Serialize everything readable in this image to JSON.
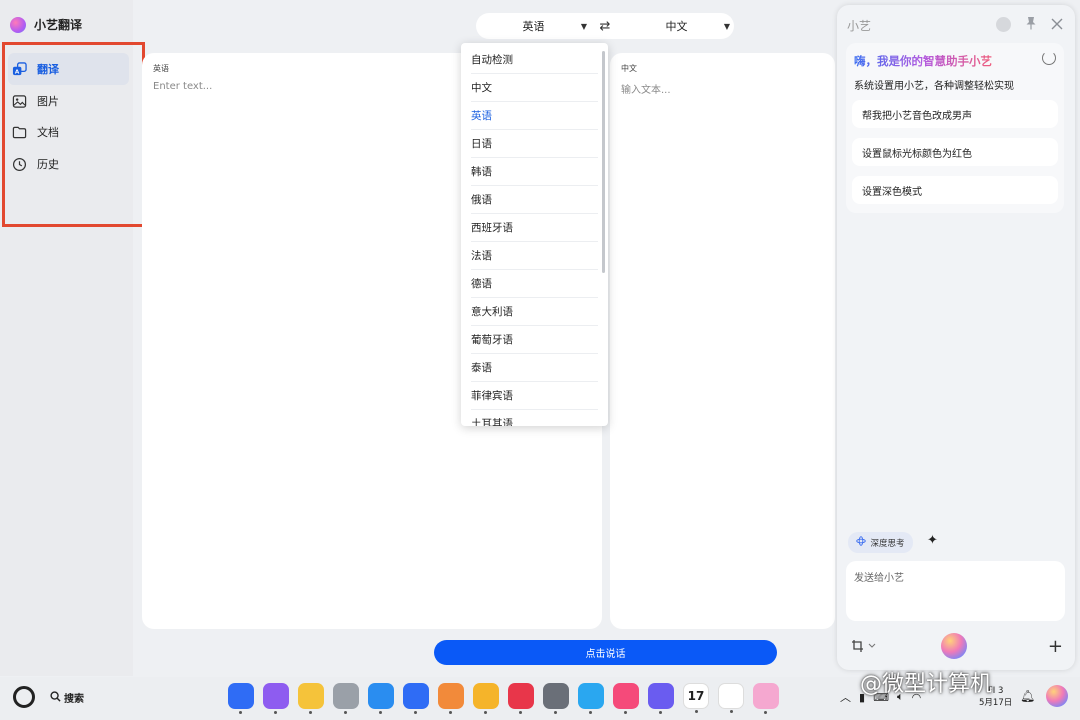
{
  "app": {
    "title": "小艺翻译"
  },
  "sidebar": {
    "items": [
      {
        "label": "翻译",
        "icon": "translate-icon",
        "active": true
      },
      {
        "label": "图片",
        "icon": "image-icon",
        "active": false
      },
      {
        "label": "文档",
        "icon": "folder-icon",
        "active": false
      },
      {
        "label": "历史",
        "icon": "clock-icon",
        "active": false
      }
    ]
  },
  "lang_bar": {
    "source": "英语",
    "target": "中文",
    "swap_symbol": "⇄"
  },
  "source_panel": {
    "label": "英语",
    "placeholder": "Enter text..."
  },
  "target_panel": {
    "label": "中文",
    "placeholder": "输入文本..."
  },
  "dropdown": {
    "selected": "英语",
    "options": [
      "自动检测",
      "中文",
      "英语",
      "日语",
      "韩语",
      "俄语",
      "西班牙语",
      "法语",
      "德语",
      "意大利语",
      "葡萄牙语",
      "泰语",
      "菲律宾语",
      "土耳其语"
    ]
  },
  "speak_button": {
    "label": "点击说话"
  },
  "assistant": {
    "title": "小艺",
    "greeting": "嗨，我是你的智慧助手小艺",
    "subtitle": "系统设置用小艺，各种调整轻松实现",
    "suggestions": [
      "帮我把小艺音色改成男声",
      "设置鼠标光标颜色为红色",
      "设置深色模式"
    ],
    "deep_think": "深度思考",
    "input_placeholder": "发送给小艺"
  },
  "taskbar": {
    "search_label": "搜索",
    "calendar_day": "17",
    "clock_time": "FI 3",
    "clock_date": "5月17日",
    "apps": [
      {
        "name": "grid-app",
        "color": "#2f6cf5"
      },
      {
        "name": "window-app",
        "color": "#8e5cf0"
      },
      {
        "name": "files-app",
        "color": "#f5c33a"
      },
      {
        "name": "trash-app",
        "color": "#9aa0a8"
      },
      {
        "name": "browser-app",
        "color": "#2a8df0"
      },
      {
        "name": "mail-app",
        "color": "#2f6cf5"
      },
      {
        "name": "gallery-app",
        "color": "#f28a3a"
      },
      {
        "name": "cards-app",
        "color": "#f5b42a"
      },
      {
        "name": "appgallery-app",
        "color": "#e8364a"
      },
      {
        "name": "settings-app",
        "color": "#6a6f78"
      },
      {
        "name": "vpn-app",
        "color": "#2aa7f0"
      },
      {
        "name": "douyin-app",
        "color": "#f54a7a"
      },
      {
        "name": "music-app",
        "color": "#6a5cf0"
      },
      {
        "name": "calendar-app",
        "color": "#ffffff"
      },
      {
        "name": "wps-app",
        "color": "#ffffff"
      },
      {
        "name": "xiaoyi-app",
        "color": "#f5a8d0"
      }
    ]
  },
  "watermark": "@微型计算机"
}
